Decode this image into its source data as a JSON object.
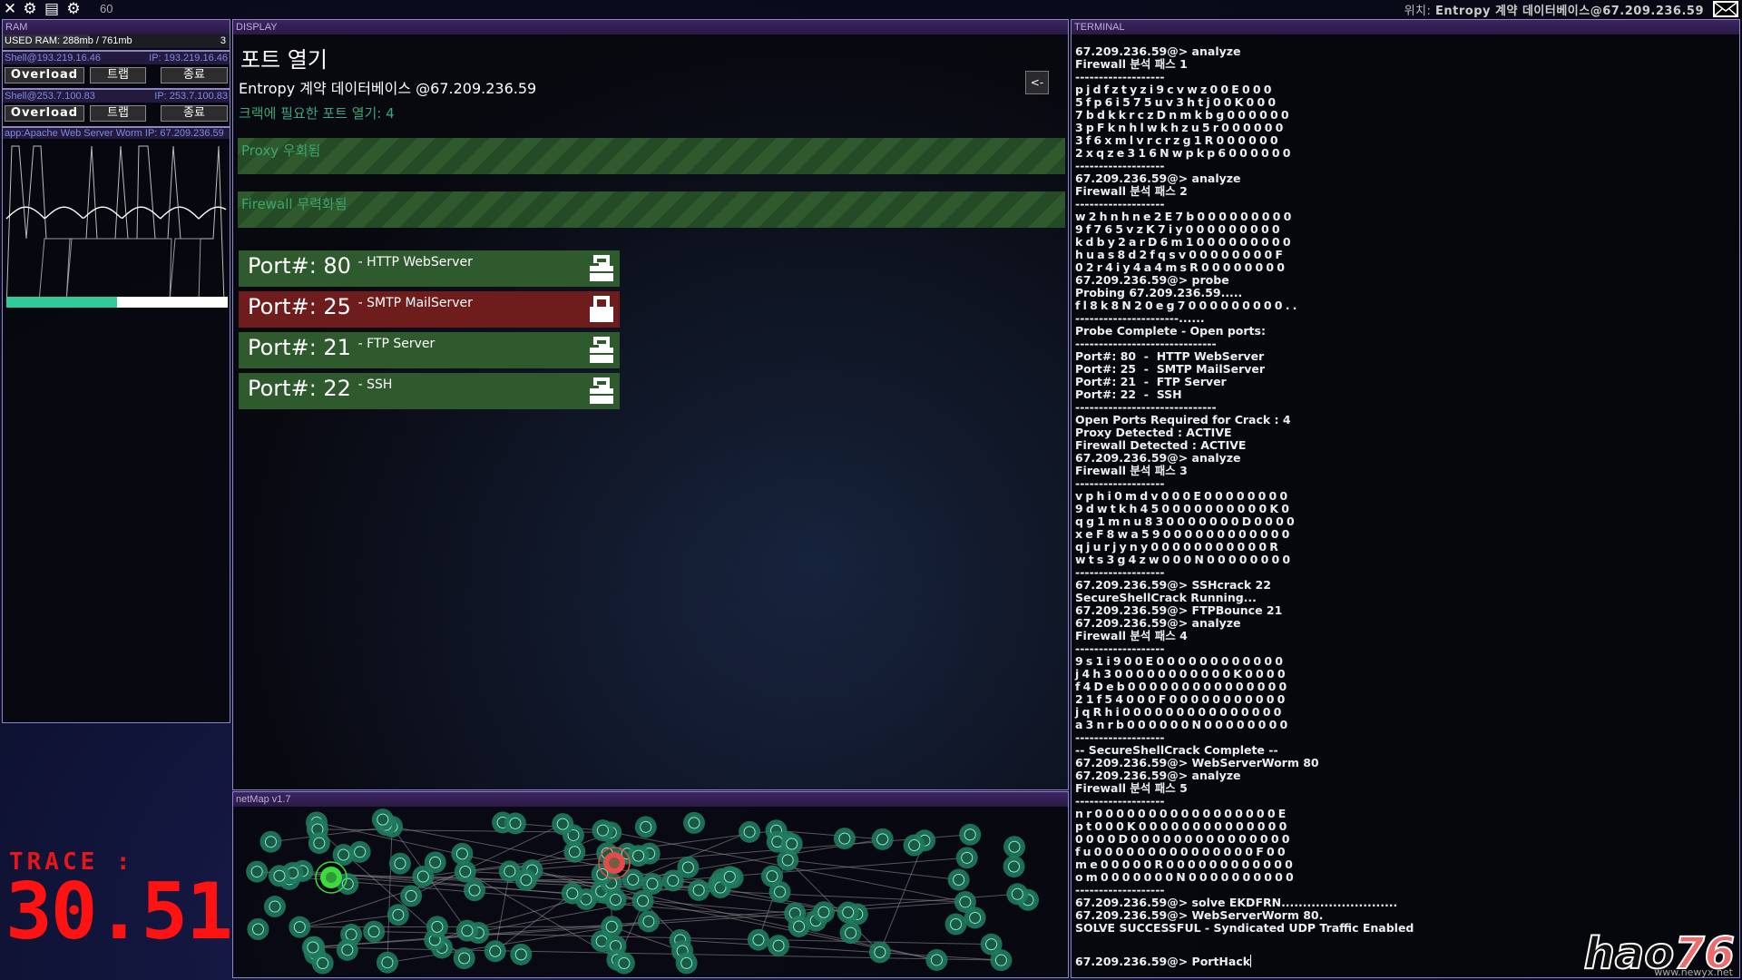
{
  "topbar": {
    "icons": [
      "close-icon",
      "settings-icon",
      "save-icon",
      "settings-icon"
    ],
    "fps": "60",
    "location_label": "위치:",
    "location_value": "Entropy 계약 데이터베이스@67.209.236.59",
    "mail_icon": "mail-icon"
  },
  "ram": {
    "header": "RAM",
    "used": "USED RAM: 288mb / 761mb",
    "used_fraction": 0.378,
    "count": "3",
    "shells": [
      {
        "name": "Shell@193.219.16.46",
        "ip": "IP: 193.219.16.46",
        "overload": "Overload",
        "trap": "트랩",
        "end": "종료"
      },
      {
        "name": "Shell@253.7.100.83",
        "ip": "IP: 253.7.100.83",
        "overload": "Overload",
        "trap": "트랩",
        "end": "종료"
      }
    ],
    "app": {
      "name": "app:Apache Web Server Worm",
      "ip": "IP: 67.209.236.59",
      "progress": 0.5
    }
  },
  "trace": {
    "label": "TRACE :",
    "value": "30.51",
    "color": "#ff1212"
  },
  "display": {
    "header": "DISPLAY",
    "title": "포트 열기",
    "subtitle": "Entropy 계약 데이터베이스 @67.209.236.59",
    "required": "크랙에 필요한 포트 열기: 4",
    "back_label": "<-",
    "banners": [
      "Proxy 우회됨",
      "Firewall 무력화됨"
    ],
    "ports": [
      {
        "label": "Port#: 80",
        "service": "HTTP WebServer",
        "status": "open"
      },
      {
        "label": "Port#: 25",
        "service": "SMTP MailServer",
        "status": "locked"
      },
      {
        "label": "Port#: 21",
        "service": "FTP Server",
        "status": "open"
      },
      {
        "label": "Port#: 22",
        "service": "SSH",
        "status": "open"
      }
    ],
    "colors": {
      "open": "#2e5a2e",
      "locked": "#6e1c1c",
      "accent": "#3aa67a"
    }
  },
  "netmap": {
    "header": "netMap v1.7"
  },
  "terminal": {
    "header": "TERMINAL",
    "lines": [
      "67.209.236.59@> analyze",
      "Firewall 분석 패스 1",
      "-------------------",
      "~p j d f z t y z i 9 c v w z 0 0 E 0 0 0",
      "~5 f p 6 i 5 7 5 u v 3 h t j 0 0 K 0 0 0",
      "~7 b d k k r c z D n m k b g 0 0 0 0 0 0",
      "~3 p F k n h l w k h z u 5 r 0 0 0 0 0 0",
      "~3 f 6 x m l v r c r z g 1 R 0 0 0 0 0 0",
      "~2 x q z e 3 1 6 N w p k p 6 0 0 0 0 0 0",
      "-------------------",
      "67.209.236.59@> analyze",
      "Firewall 분석 패스 2",
      "-------------------",
      "~w 2 h n h n e 2 E 7 b 0 0 0 0 0 0 0 0 0",
      "~9 f 7 6 5 v z K 7 i y 0 0 0 0 0 0 0 0 0",
      "~k d b y 2 a r D 6 m 1 0 0 0 0 0 0 0 0 0",
      "~h u a s 8 d 2 f q s v 0 0 0 0 0 0 0 0 F",
      "~0 2 r 4 i y 4 a 4 m s R 0 0 0 0 0 0 0 0",
      "67.209.236.59@> probe",
      "Probing 67.209.236.59.....",
      "~f l 8 k 8 N 2 0 e g 7 0 0 0 0 0 0 0 0 0..",
      "----------------------......",
      "Probe Complete - Open ports:",
      "------------------------------",
      "Port#: 80  -  HTTP WebServer",
      "Port#: 25  -  SMTP MailServer",
      "Port#: 21  -  FTP Server",
      "Port#: 22  -  SSH",
      "------------------------------",
      "Open Ports Required for Crack : 4",
      "Proxy Detected : ACTIVE",
      "Firewall Detected : ACTIVE",
      "67.209.236.59@> analyze",
      "Firewall 분석 패스 3",
      "-------------------",
      "~v p h i 0 m d v 0 0 0 E 0 0 0 0 0 0 0 0",
      "~9 d w t k h 4 5 0 0 0 0 0 0 0 0 0 0 K 0",
      "~q g 1 m n u 8 3 0 0 0 0 0 0 0 D 0 0 0 0",
      "~x e F 8 w a 5 9 0 0 0 0 0 0 0 0 0 0 0 0",
      "~q j u r j y n y 0 0 0 0 0 0 0 0 0 0 0 R",
      "~w t s 3 g 4 z w 0 0 0 N 0 0 0 0 0 0 0 0",
      "-------------------",
      "67.209.236.59@> SSHcrack 22",
      "SecureShellCrack Running...",
      "67.209.236.59@> FTPBounce 21",
      "67.209.236.59@> analyze",
      "Firewall 분석 패스 4",
      "-------------------",
      "~9 s 1 i 9 0 0 E 0 0 0 0 0 0 0 0 0 0 0 0",
      "~j 4 h 3 0 0 0 0 0 0 0 0 0 0 0 K 0 0 0 0",
      "~f 4 D e b 0 0 0 0 0 0 0 0 0 0 0 0 0 0 0",
      "~2 1 f 5 4 0 0 0 F 0 0 0 0 0 0 0 0 0 0 0",
      "~j q R h i 0 0 0 0 0 0 0 0 0 0 0 0 0 0 0",
      "~a 3 n r b 0 0 0 0 0 0 N 0 0 0 0 0 0 0 0",
      "-------------------",
      "-- SecureShellCrack Complete --",
      "67.209.236.59@> WebServerWorm 80",
      "67.209.236.59@> analyze",
      "Firewall 분석 패스 5",
      "-------------------",
      "~n r 0 0 0 0 0 0 0 0 0 0 0 0 0 0 0 0 0 E",
      "~p t 0 0 0 K 0 0 0 0 0 0 0 0 0 0 0 0 0 0",
      "~0 0 0 0 D 0 0 0 0 0 0 0 0 0 0 0 0 0 0 0",
      "~f u 0 0 0 0 0 0 0 0 0 0 0 0 0 0 0 F 0 0",
      "~m e 0 0 0 0 0 R 0 0 0 0 0 0 0 0 0 0 0 0",
      "~o m 0 0 0 0 0 0 0 N 0 0 0 0 0 0 0 0 0 0",
      "-------------------",
      "67.209.236.59@> solve EKDFRN...........................",
      "67.209.236.59@> WebServerWorm 80.",
      "SOLVE SUCCESSFUL - Syndicated UDP Traffic Enabled"
    ],
    "prompt": "67.209.236.59@> ",
    "input_value": "PortHack"
  },
  "watermark": {
    "part1": "hao",
    "part2": "76",
    "sub": "www.newyx.net"
  }
}
